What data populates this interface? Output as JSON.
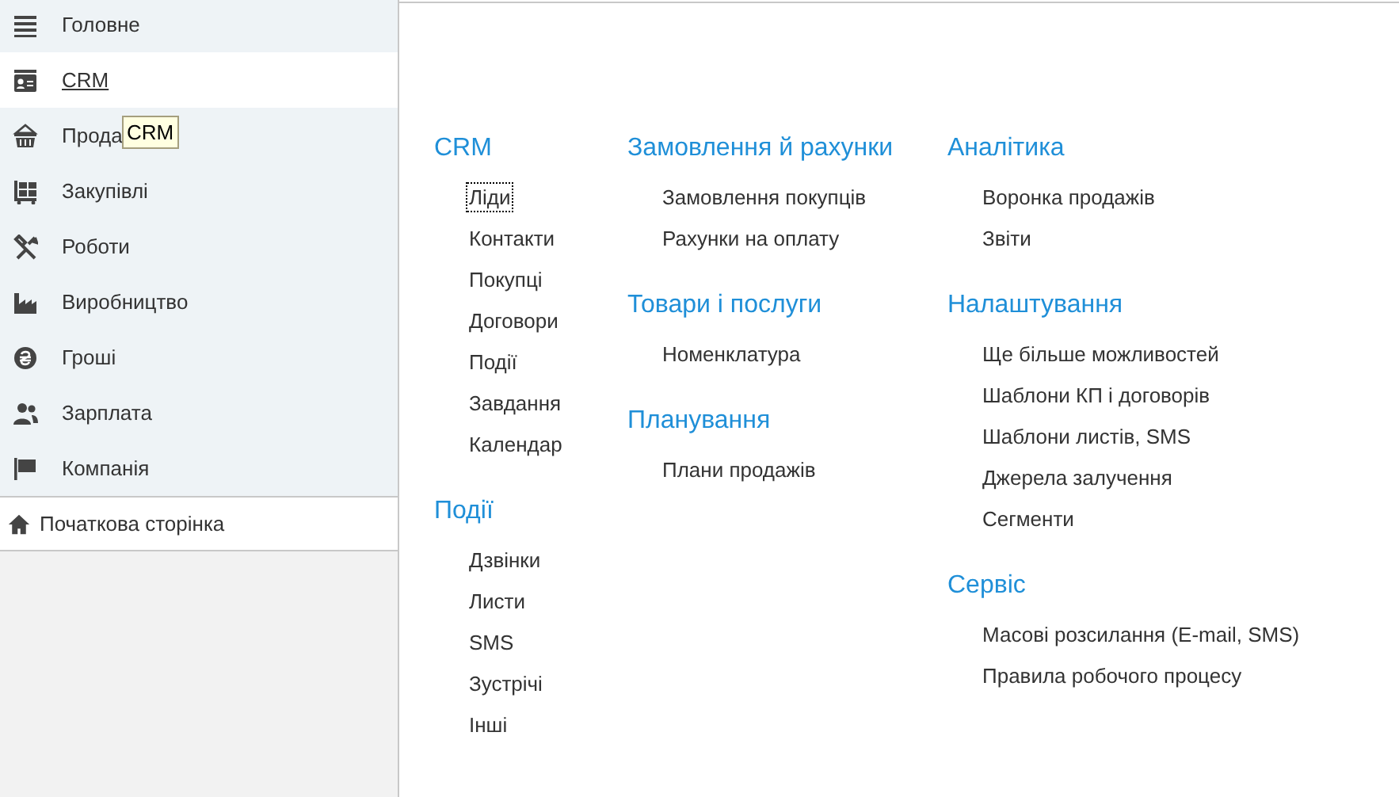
{
  "sidebar": {
    "items": [
      {
        "label": "Головне",
        "selected": false
      },
      {
        "label": "CRM",
        "selected": true
      },
      {
        "label": "Прода",
        "selected": false
      },
      {
        "label": "Закупівлі",
        "selected": false
      },
      {
        "label": "Роботи",
        "selected": false
      },
      {
        "label": "Виробництво",
        "selected": false
      },
      {
        "label": "Гроші",
        "selected": false
      },
      {
        "label": "Зарплата",
        "selected": false
      },
      {
        "label": "Компанія",
        "selected": false
      }
    ],
    "home": {
      "label": "Початкова сторінка"
    }
  },
  "tooltip": {
    "text": "CRM"
  },
  "columns": [
    {
      "sections": [
        {
          "title": "CRM",
          "items": [
            {
              "label": "Ліди",
              "focused": true
            },
            {
              "label": "Контакти",
              "focused": false
            },
            {
              "label": "Покупці",
              "focused": false
            },
            {
              "label": "Договори",
              "focused": false
            },
            {
              "label": "Події",
              "focused": false
            },
            {
              "label": "Завдання",
              "focused": false
            },
            {
              "label": "Календар",
              "focused": false
            }
          ]
        },
        {
          "title": "Події",
          "items": [
            {
              "label": "Дзвінки",
              "focused": false
            },
            {
              "label": "Листи",
              "focused": false
            },
            {
              "label": "SMS",
              "focused": false
            },
            {
              "label": "Зустрічі",
              "focused": false
            },
            {
              "label": "Інші",
              "focused": false
            }
          ]
        }
      ]
    },
    {
      "sections": [
        {
          "title": "Замовлення й рахунки",
          "items": [
            {
              "label": "Замовлення покупців",
              "focused": false
            },
            {
              "label": "Рахунки на оплату",
              "focused": false
            }
          ]
        },
        {
          "title": "Товари і послуги",
          "items": [
            {
              "label": "Номенклатура",
              "focused": false
            }
          ]
        },
        {
          "title": "Планування",
          "items": [
            {
              "label": "Плани продажів",
              "focused": false
            }
          ]
        }
      ]
    },
    {
      "sections": [
        {
          "title": "Аналітика",
          "items": [
            {
              "label": "Воронка продажів",
              "focused": false
            },
            {
              "label": "Звіти",
              "focused": false
            }
          ]
        },
        {
          "title": "Налаштування",
          "items": [
            {
              "label": "Ще більше можливостей",
              "focused": false
            },
            {
              "label": "Шаблони КП і договорів",
              "focused": false
            },
            {
              "label": "Шаблони листів, SMS",
              "focused": false
            },
            {
              "label": "Джерела залучення",
              "focused": false
            },
            {
              "label": "Сегменти",
              "focused": false
            }
          ]
        },
        {
          "title": "Сервіс",
          "items": [
            {
              "label": "Масові розсилання (E-mail, SMS)",
              "focused": false
            },
            {
              "label": "Правила робочого процесу",
              "focused": false
            }
          ]
        }
      ]
    }
  ]
}
